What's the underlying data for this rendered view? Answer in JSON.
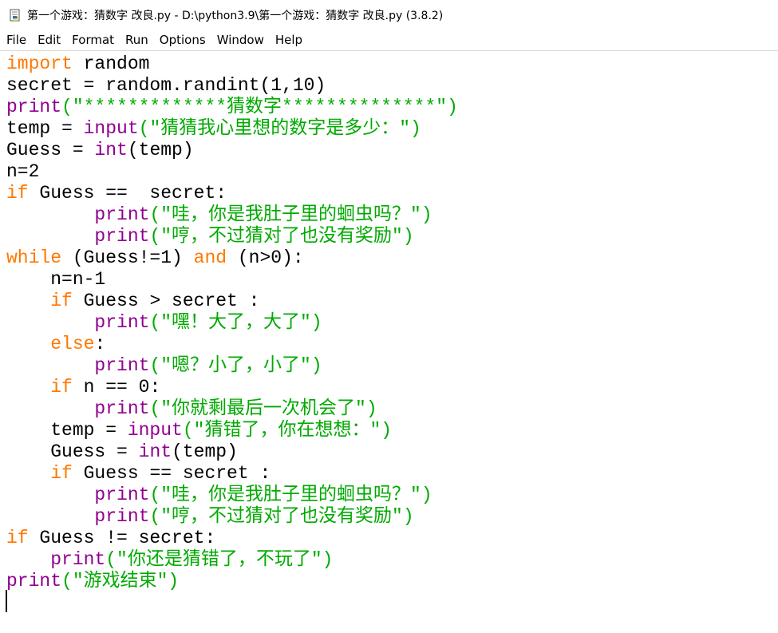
{
  "window": {
    "title": "第一个游戏：猜数字 改良.py - D:\\python3.9\\第一个游戏：猜数字 改良.py (3.8.2)"
  },
  "menu": [
    "File",
    "Edit",
    "Format",
    "Run",
    "Options",
    "Window",
    "Help"
  ],
  "colors": {
    "keyword": "#ff7700",
    "builtin": "#900090",
    "string": "#00aa00",
    "default": "#000000"
  },
  "code_lines": [
    [
      {
        "t": "import",
        "c": "kw"
      },
      {
        "t": " random"
      }
    ],
    [
      {
        "t": "secret = random.randint(1,10)"
      }
    ],
    [
      {
        "t": "print",
        "c": "bi"
      },
      {
        "t": "(\"*************猜数字**************\")",
        "c": "st"
      }
    ],
    [
      {
        "t": "temp = "
      },
      {
        "t": "input",
        "c": "bi"
      },
      {
        "t": "(\"猜猜我心里想的数字是多少：\")",
        "c": "st"
      }
    ],
    [
      {
        "t": "Guess = "
      },
      {
        "t": "int",
        "c": "bi"
      },
      {
        "t": "(temp)"
      }
    ],
    [
      {
        "t": "n=2"
      }
    ],
    [
      {
        "t": "if",
        "c": "kw"
      },
      {
        "t": " Guess ==  secret:"
      }
    ],
    [
      {
        "t": "        "
      },
      {
        "t": "print",
        "c": "bi"
      },
      {
        "t": "(\"哇，你是我肚子里的蛔虫吗？\")",
        "c": "st"
      }
    ],
    [
      {
        "t": "        "
      },
      {
        "t": "print",
        "c": "bi"
      },
      {
        "t": "(\"哼，不过猜对了也没有奖励\")",
        "c": "st"
      }
    ],
    [
      {
        "t": "while",
        "c": "kw"
      },
      {
        "t": " (Guess!=1) "
      },
      {
        "t": "and",
        "c": "kw"
      },
      {
        "t": " (n>0):"
      }
    ],
    [
      {
        "t": "    n=n-1"
      }
    ],
    [
      {
        "t": "    "
      },
      {
        "t": "if",
        "c": "kw"
      },
      {
        "t": " Guess > secret :"
      }
    ],
    [
      {
        "t": "        "
      },
      {
        "t": "print",
        "c": "bi"
      },
      {
        "t": "(\"嘿！大了，大了\")",
        "c": "st"
      }
    ],
    [
      {
        "t": "    "
      },
      {
        "t": "else",
        "c": "kw"
      },
      {
        "t": ":"
      }
    ],
    [
      {
        "t": "        "
      },
      {
        "t": "print",
        "c": "bi"
      },
      {
        "t": "(\"嗯？小了，小了\")",
        "c": "st"
      }
    ],
    [
      {
        "t": "    "
      },
      {
        "t": "if",
        "c": "kw"
      },
      {
        "t": " n == 0:"
      }
    ],
    [
      {
        "t": "        "
      },
      {
        "t": "print",
        "c": "bi"
      },
      {
        "t": "(\"你就剩最后一次机会了\")",
        "c": "st"
      }
    ],
    [
      {
        "t": "    temp = "
      },
      {
        "t": "input",
        "c": "bi"
      },
      {
        "t": "(\"猜错了，你在想想：\")",
        "c": "st"
      }
    ],
    [
      {
        "t": "    Guess = "
      },
      {
        "t": "int",
        "c": "bi"
      },
      {
        "t": "(temp)"
      }
    ],
    [
      {
        "t": "    "
      },
      {
        "t": "if",
        "c": "kw"
      },
      {
        "t": " Guess == secret :"
      }
    ],
    [
      {
        "t": "        "
      },
      {
        "t": "print",
        "c": "bi"
      },
      {
        "t": "(\"哇，你是我肚子里的蛔虫吗？\")",
        "c": "st"
      }
    ],
    [
      {
        "t": "        "
      },
      {
        "t": "print",
        "c": "bi"
      },
      {
        "t": "(\"哼，不过猜对了也没有奖励\")",
        "c": "st"
      }
    ],
    [
      {
        "t": "if",
        "c": "kw"
      },
      {
        "t": " Guess != secret:"
      }
    ],
    [
      {
        "t": "    "
      },
      {
        "t": "print",
        "c": "bi"
      },
      {
        "t": "(\"你还是猜错了，不玩了\")",
        "c": "st"
      }
    ],
    [
      {
        "t": "print",
        "c": "bi"
      },
      {
        "t": "(\"游戏结束\")",
        "c": "st"
      }
    ]
  ]
}
